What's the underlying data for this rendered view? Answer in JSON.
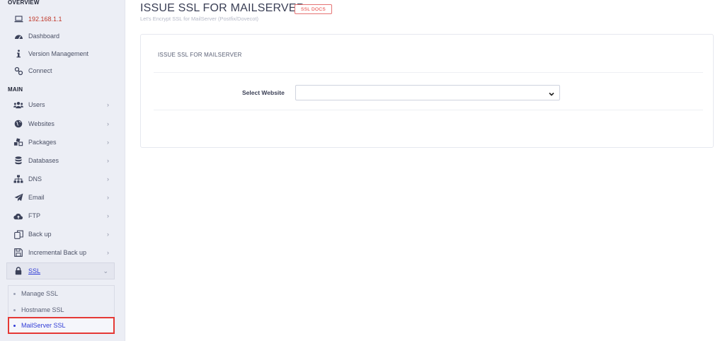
{
  "sidebar": {
    "overview_header": "OVERVIEW",
    "main_header": "MAIN",
    "overview_items": [
      {
        "label": "192.168.1.1",
        "icon": "laptop-icon"
      },
      {
        "label": "Dashboard",
        "icon": "dashboard-icon"
      },
      {
        "label": "Version Management",
        "icon": "info-icon"
      },
      {
        "label": "Connect",
        "icon": "link-icon"
      }
    ],
    "main_items": [
      {
        "label": "Users",
        "icon": "users-icon"
      },
      {
        "label": "Websites",
        "icon": "globe-icon"
      },
      {
        "label": "Packages",
        "icon": "cubes-icon"
      },
      {
        "label": "Databases",
        "icon": "database-icon"
      },
      {
        "label": "DNS",
        "icon": "sitemap-icon"
      },
      {
        "label": "Email",
        "icon": "paper-plane-icon"
      },
      {
        "label": "FTP",
        "icon": "cloud-upload-icon"
      },
      {
        "label": "Back up",
        "icon": "copy-icon"
      },
      {
        "label": "Incremental Back up",
        "icon": "save-icon"
      }
    ],
    "ssl": {
      "label": "SSL",
      "icon": "lock-icon"
    },
    "ssl_sub": [
      "Manage SSL",
      "Hostname SSL",
      "MailServer SSL"
    ]
  },
  "header": {
    "title": "ISSUE SSL FOR MAILSERVER -",
    "docs_badge": "SSL DOCS",
    "subtitle": "Let's Encrypt SSL for MailServer (Postfix/Dovecot)"
  },
  "card": {
    "title": "ISSUE SSL FOR MAILSERVER",
    "select_label": "Select Website",
    "select_value": ""
  },
  "colors": {
    "accent": "#2f3bd6",
    "badge": "#e53935",
    "sidebar_bg": "#eceef5",
    "highlight_border": "#e53935"
  }
}
